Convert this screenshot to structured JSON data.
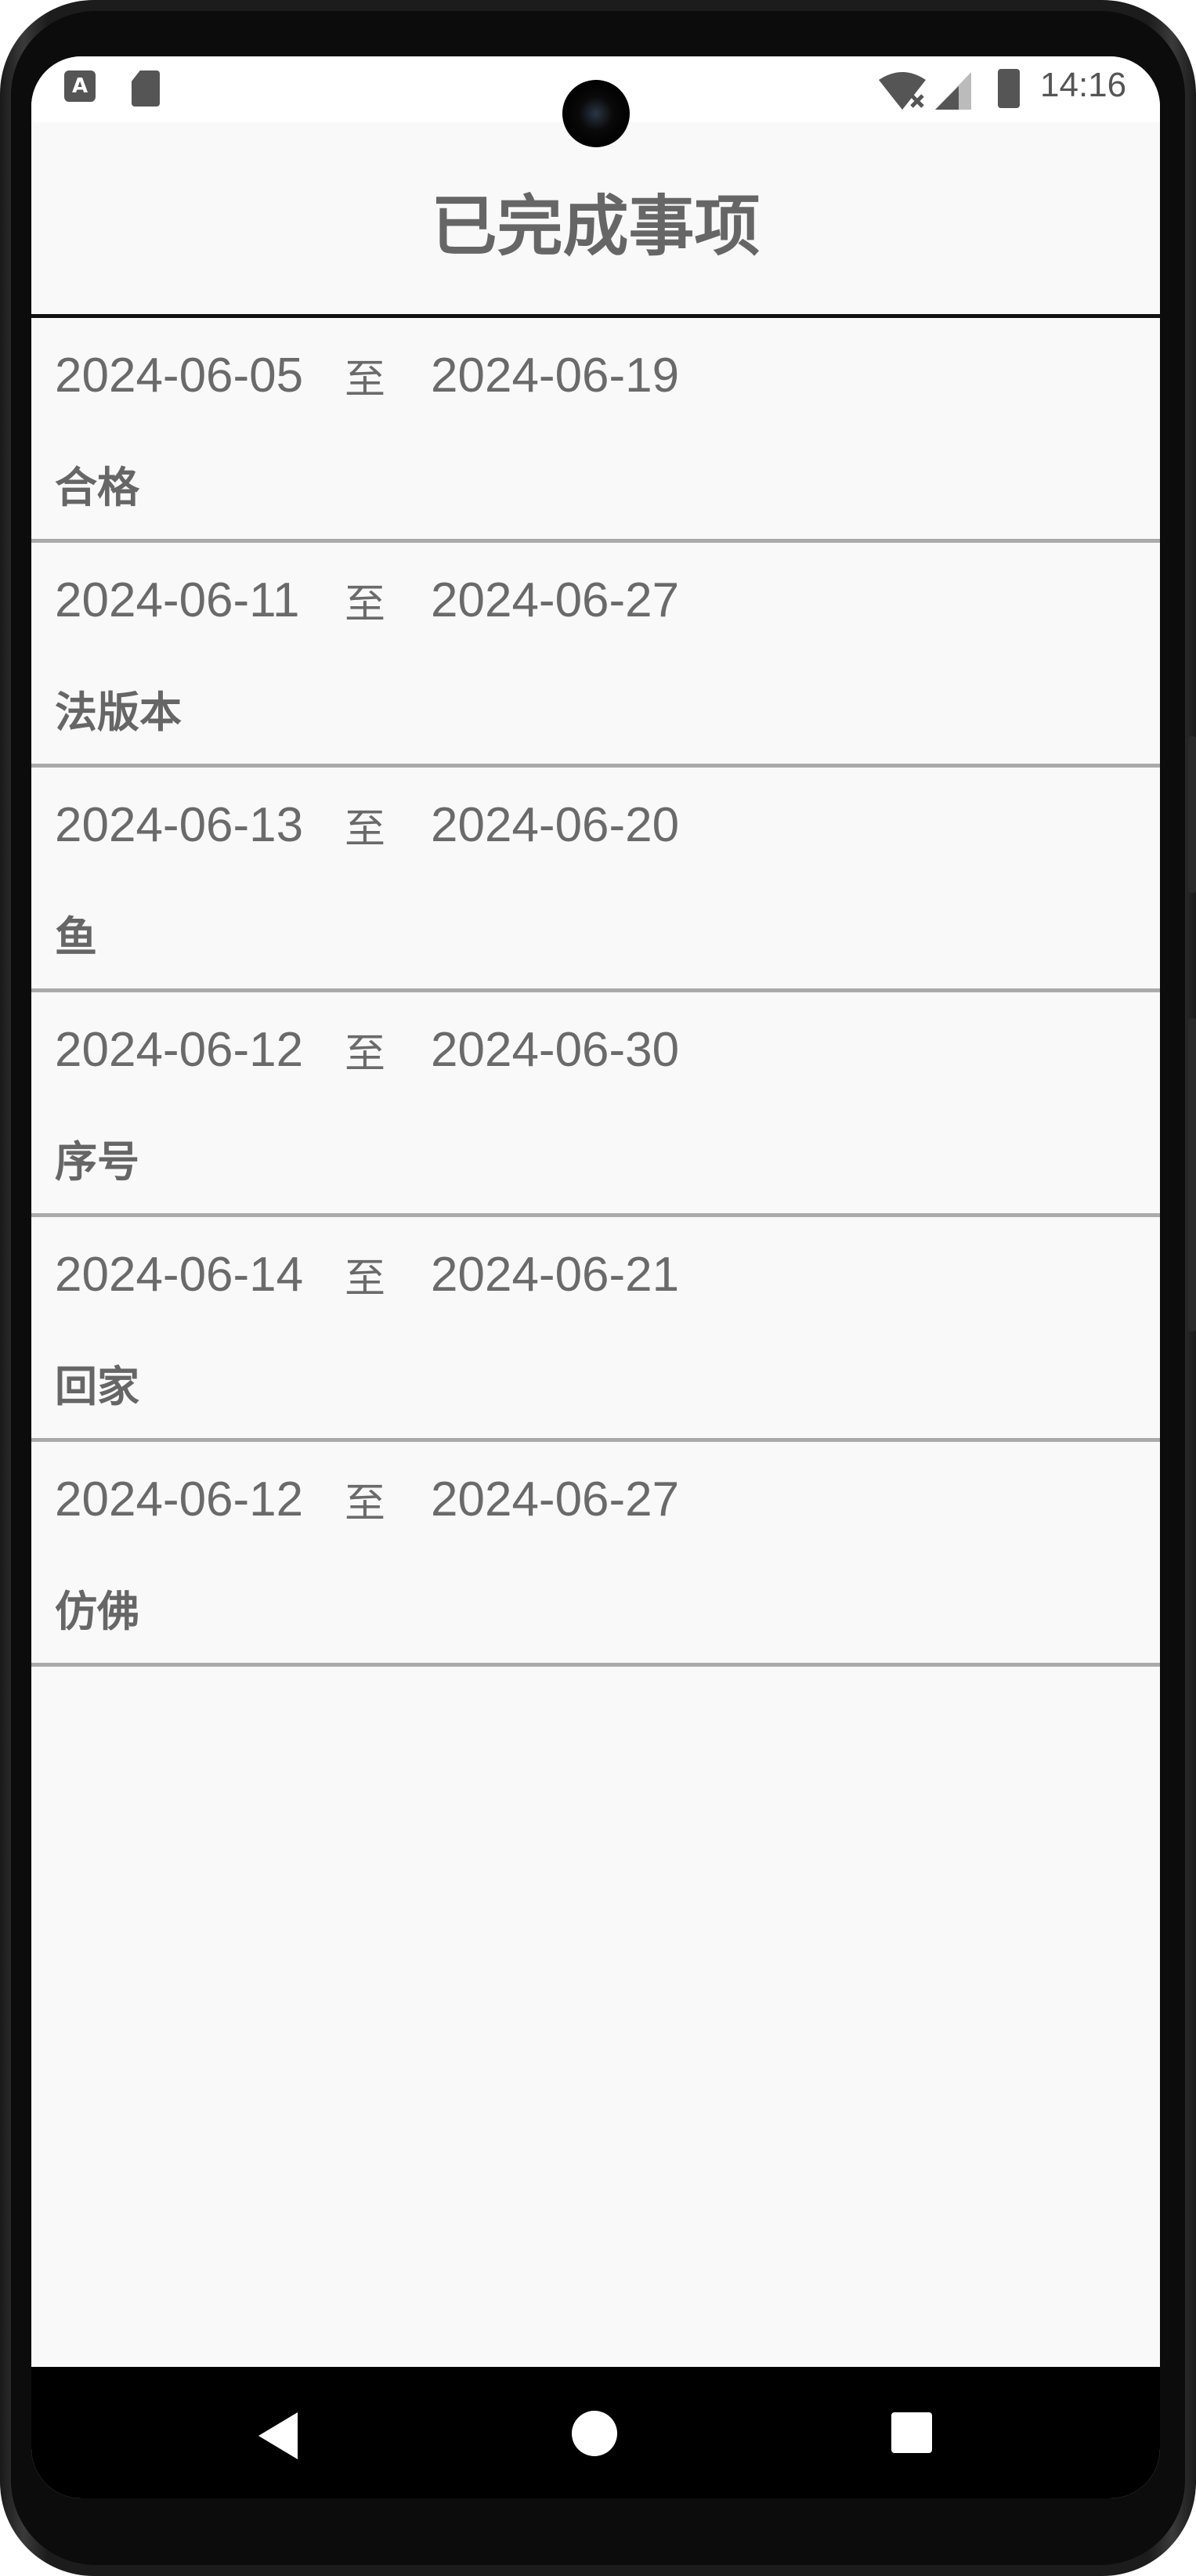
{
  "status_bar": {
    "time": "14:16",
    "notification_a_label": "A",
    "icons": [
      "text-notification-icon",
      "sd-card-icon",
      "wifi-off-icon",
      "signal-icon",
      "battery-icon"
    ]
  },
  "app": {
    "title": "已完成事项"
  },
  "items": [
    {
      "start": "2024-06-05",
      "sep": "至",
      "end": "2024-06-19",
      "name": "合格"
    },
    {
      "start": "2024-06-11",
      "sep": "至",
      "end": "2024-06-27",
      "name": "法版本"
    },
    {
      "start": "2024-06-13",
      "sep": "至",
      "end": "2024-06-20",
      "name": "鱼"
    },
    {
      "start": "2024-06-12",
      "sep": "至",
      "end": "2024-06-30",
      "name": "序号"
    },
    {
      "start": "2024-06-14",
      "sep": "至",
      "end": "2024-06-21",
      "name": "回家"
    },
    {
      "start": "2024-06-12",
      "sep": "至",
      "end": "2024-06-27",
      "name": "仿佛"
    }
  ],
  "colors": {
    "background": "#f9f9f9",
    "text": "#6a6a6a",
    "divider": "#aaaaaa",
    "title_underline": "#111111",
    "nav_bar": "#000000"
  }
}
